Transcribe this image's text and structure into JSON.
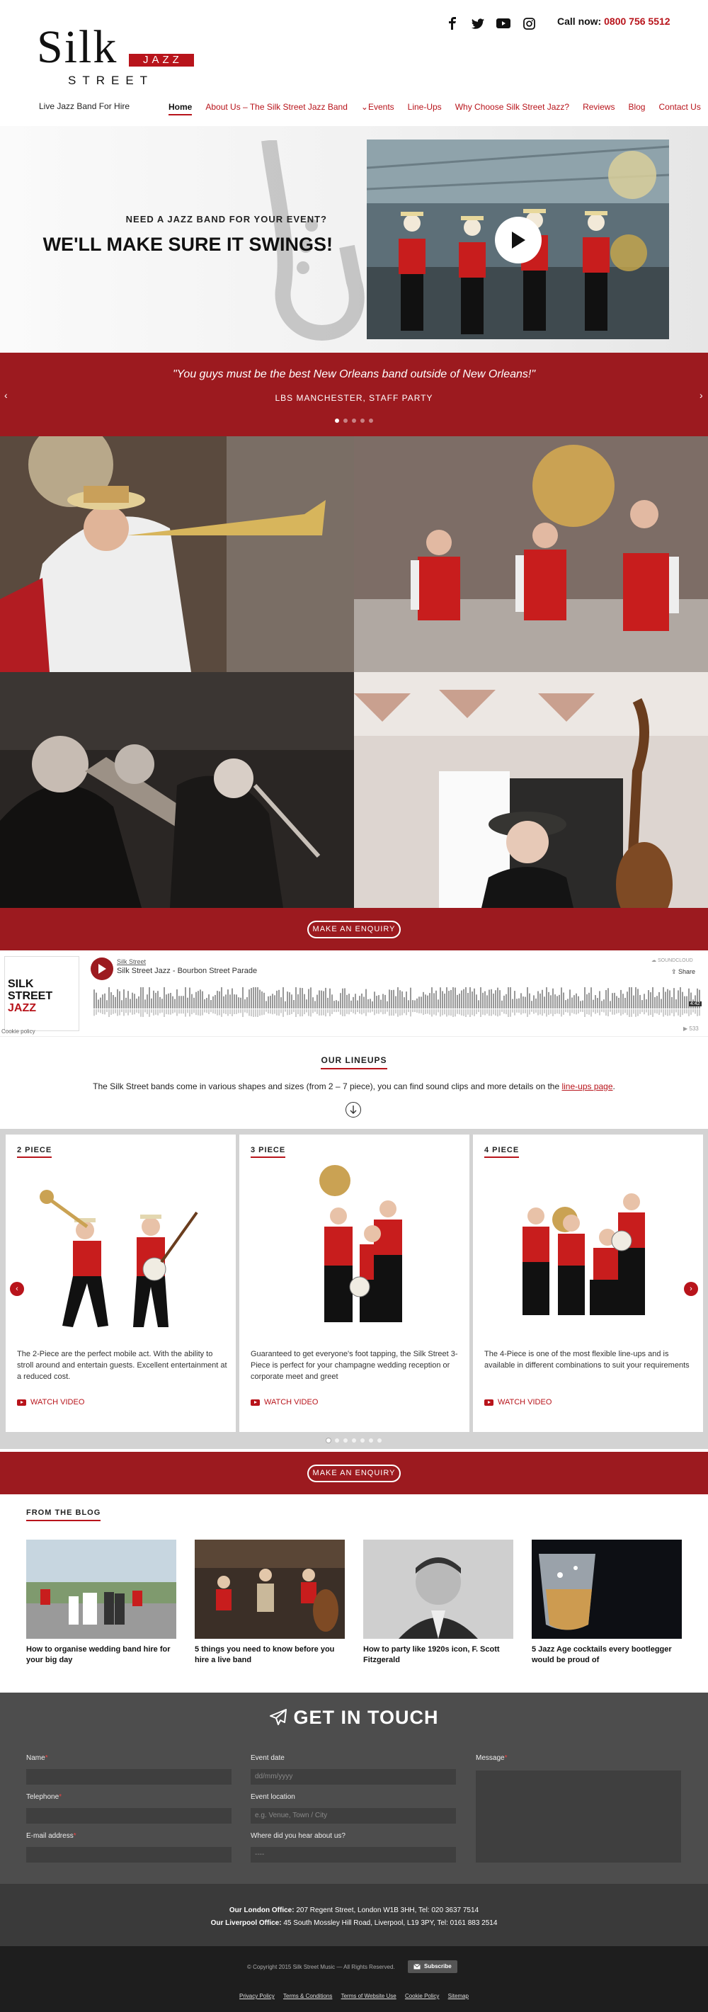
{
  "header": {
    "logo": {
      "silk": "Silk",
      "jazz": "JAZZ",
      "street": "STREET"
    },
    "social": [
      {
        "icon": "facebook-icon"
      },
      {
        "icon": "twitter-icon"
      },
      {
        "icon": "youtube-icon"
      },
      {
        "icon": "instagram-icon"
      }
    ],
    "call_label": "Call now:",
    "call_number": "0800 756 5512",
    "tagline": "Live Jazz Band For Hire",
    "nav": [
      {
        "label": "Home",
        "active": true
      },
      {
        "label": "About Us – The Silk Street Jazz Band"
      },
      {
        "label": "⌄Events"
      },
      {
        "label": "Line-Ups"
      },
      {
        "label": "Why Choose Silk Street Jazz?"
      },
      {
        "label": "Reviews"
      },
      {
        "label": "Blog"
      },
      {
        "label": "Contact Us"
      }
    ]
  },
  "hero": {
    "pretitle": "NEED A JAZZ BAND FOR YOUR EVENT?",
    "title": "WE'LL MAKE SURE IT SWINGS!"
  },
  "testimonial": {
    "quote": "\"You guys must be the best New Orleans band outside of New Orleans!\"",
    "author": "LBS MANCHESTER, STAFF PARTY",
    "prev": "‹",
    "next": "›"
  },
  "enquiry": {
    "label": "MAKE AN ENQUIRY"
  },
  "soundcloud": {
    "user": "Silk Street",
    "track": "Silk Street Jazz - Bourbon Street Parade",
    "brand": "SOUNDCLOUD",
    "share": "Share",
    "duration": "4:42",
    "plays": "533",
    "cookie": "Cookie policy",
    "art": {
      "line1": "SILK",
      "line2": "STREET",
      "line3": "JAZZ"
    }
  },
  "lineups": {
    "heading": "OUR LINEUPS",
    "intro_before": "The Silk Street bands come in various shapes and sizes (from 2 – 7 piece), you can find sound clips and more details on the ",
    "intro_link": "line-ups page",
    "intro_after": ".",
    "cards": [
      {
        "title": "2 PIECE",
        "desc": "The 2-Piece are the perfect mobile act. With the ability to stroll around and entertain guests. Excellent entertainment at a reduced cost.",
        "link": "WATCH VIDEO"
      },
      {
        "title": "3 PIECE",
        "desc": "Guaranteed to get everyone's foot tapping, the Silk Street 3-Piece is perfect for your champagne wedding reception or corporate meet and greet",
        "link": "WATCH VIDEO"
      },
      {
        "title": "4 PIECE",
        "desc": "The 4-Piece is one of the most flexible line-ups and is available in different combinations to suit your requirements",
        "link": "WATCH VIDEO"
      }
    ],
    "prev": "‹",
    "next": "›"
  },
  "blog": {
    "heading": "FROM THE BLOG",
    "posts": [
      {
        "title": "How to organise wedding band hire for your big day"
      },
      {
        "title": "5 things you need to know before you hire a live band"
      },
      {
        "title": "How to party like 1920s icon, F. Scott Fitzgerald"
      },
      {
        "title": "5 Jazz Age cocktails every bootlegger would be proud of"
      }
    ]
  },
  "contact": {
    "title": "GET IN TOUCH",
    "name_label": "Name",
    "telephone_label": "Telephone",
    "email_label": "E-mail address",
    "date_label": "Event date",
    "date_placeholder": "dd/mm/yyyy",
    "location_label": "Event location",
    "location_placeholder": "e.g. Venue, Town / City",
    "hear_label": "Where did you hear about us?",
    "hear_value": "----",
    "message_label": "Message",
    "required_mark": "*"
  },
  "footer": {
    "london_label": "Our London Office:",
    "london": "207 Regent Street, London W1B 3HH, Tel: 020 3637 7514",
    "liverpool_label": "Our Liverpool Office:",
    "liverpool": "45 South Mossley Hill Road, Liverpool, L19 3PY, Tel: 0161 883 2514",
    "copyright": "© Copyright 2015 Silk Street Music — All Rights Reserved.",
    "subscribe": "Subscribe",
    "links": [
      "Privacy Policy",
      "Terms & Conditions",
      "Terms of Website Use",
      "Cookie Policy",
      "Sitemap"
    ]
  },
  "colors": {
    "brand_red": "#b8141b",
    "band_red": "#9c1a1f",
    "contact_bg": "#4d4d4d"
  }
}
